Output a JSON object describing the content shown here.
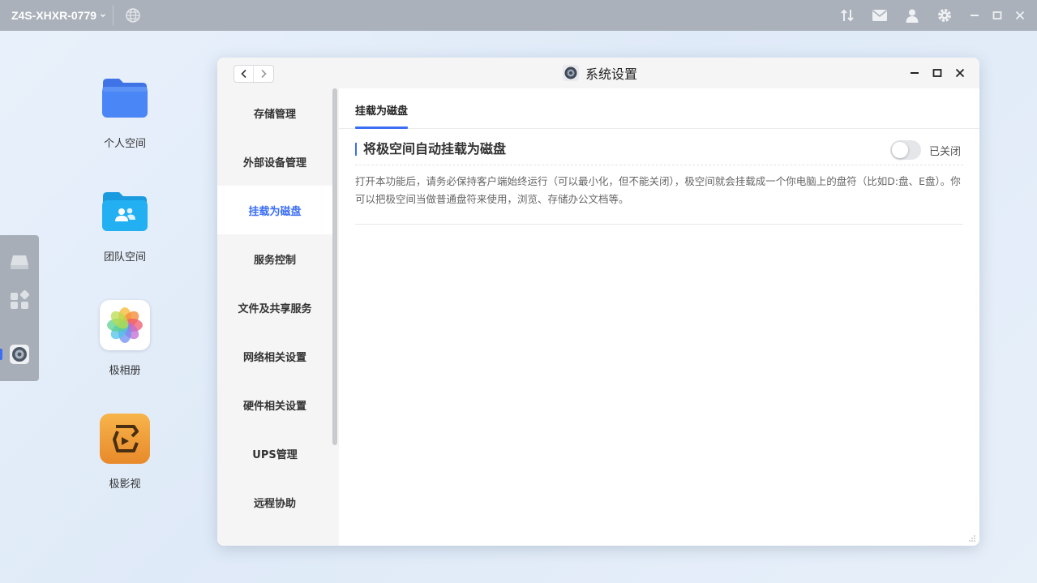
{
  "topbar": {
    "device_name": "Z4S-XHXR-0779",
    "icons": [
      "transfer-icon",
      "mail-icon",
      "user-icon",
      "gear-icon",
      "minimize-icon",
      "maximize-icon",
      "close-icon"
    ]
  },
  "desktop": {
    "apps": [
      {
        "label": "个人空间",
        "icon": "folder-icon"
      },
      {
        "label": "团队空间",
        "icon": "team-folder-icon"
      },
      {
        "label": "极相册",
        "icon": "photos-icon"
      },
      {
        "label": "极影视",
        "icon": "video-icon"
      }
    ]
  },
  "dock": {
    "icons": [
      "drive-icon",
      "apps-grid-icon",
      "settings-app-icon"
    ]
  },
  "window": {
    "title": "系统设置",
    "sidebar": {
      "items": [
        {
          "label": "存储管理"
        },
        {
          "label": "外部设备管理"
        },
        {
          "label": "挂载为磁盘",
          "active": true
        },
        {
          "label": "服务控制"
        },
        {
          "label": "文件及共享服务"
        },
        {
          "label": "网络相关设置"
        },
        {
          "label": "硬件相关设置"
        },
        {
          "label": "UPS管理"
        },
        {
          "label": "远程协助"
        }
      ]
    },
    "tab": {
      "label": "挂载为磁盘"
    },
    "section": {
      "title": "将极空间自动挂载为磁盘",
      "toggle_state": "已关闭",
      "toggle_on": false,
      "description": "打开本功能后，请务必保持客户端始终运行（可以最小化，但不能关闭），极空间就会挂载成一个你电脑上的盘符（比如D:盘、E盘）。你可以把极空间当做普通盘符来使用，浏览、存储办公文档等。"
    }
  },
  "colors": {
    "accent": "#3b6ef5",
    "topbar": "#aab1ba",
    "sidebar_bg": "#f5f5f6"
  }
}
